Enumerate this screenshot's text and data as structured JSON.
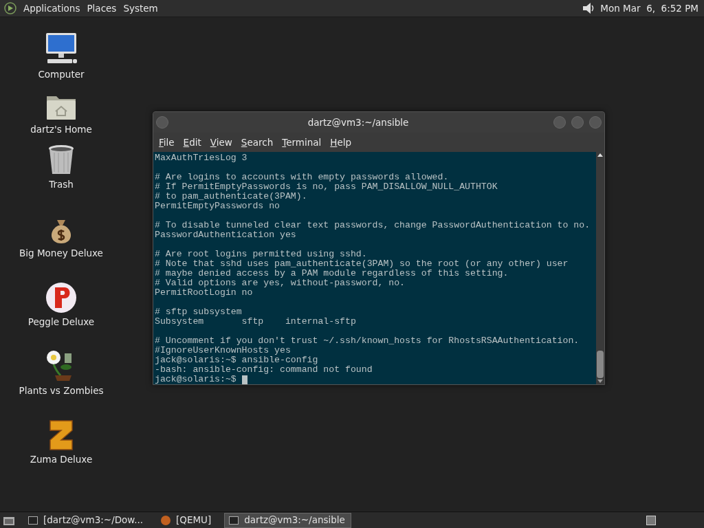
{
  "top_panel": {
    "menus": [
      "Applications",
      "Places",
      "System"
    ],
    "clock": "Mon Mar  6,  6:52 PM"
  },
  "desktop_icons": [
    {
      "label": "Computer",
      "kind": "computer"
    },
    {
      "label": "dartz's Home",
      "kind": "home"
    },
    {
      "label": "Trash",
      "kind": "trash"
    },
    {
      "label": "Big Money Deluxe",
      "kind": "moneybag"
    },
    {
      "label": "Peggle Deluxe",
      "kind": "peggle"
    },
    {
      "label": "Plants vs Zombies",
      "kind": "plant"
    },
    {
      "label": "Zuma Deluxe",
      "kind": "zuma"
    }
  ],
  "terminal": {
    "title": "dartz@vm3:~/ansible",
    "menu": [
      "File",
      "Edit",
      "View",
      "Search",
      "Terminal",
      "Help"
    ],
    "blocks": [
      [
        "MaxAuthTriesLog 3"
      ],
      [
        "# Are logins to accounts with empty passwords allowed.",
        "# If PermitEmptyPasswords is no, pass PAM_DISALLOW_NULL_AUTHTOK",
        "# to pam_authenticate(3PAM).",
        "PermitEmptyPasswords no"
      ],
      [
        "# To disable tunneled clear text passwords, change PasswordAuthentication to no.",
        "PasswordAuthentication yes"
      ],
      [
        "# Are root logins permitted using sshd.",
        "# Note that sshd uses pam_authenticate(3PAM) so the root (or any other) user",
        "# maybe denied access by a PAM module regardless of this setting.",
        "# Valid options are yes, without-password, no.",
        "PermitRootLogin no"
      ],
      [
        "# sftp subsystem",
        "Subsystem       sftp    internal-sftp"
      ],
      [
        "# Uncomment if you don't trust ~/.ssh/known_hosts for RhostsRSAAuthentication.",
        "#IgnoreUserKnownHosts yes",
        "jack@solaris:~$ ansible-config",
        "-bash: ansible-config: command not found"
      ]
    ],
    "prompt": "jack@solaris:~$ "
  },
  "taskbar": {
    "tasks": [
      {
        "label": "[dartz@vm3:~/Dow...",
        "kind": "terminal",
        "selected": false
      },
      {
        "label": "[QEMU]",
        "kind": "qemu",
        "selected": false
      },
      {
        "label": "dartz@vm3:~/ansible",
        "kind": "terminal",
        "selected": true
      }
    ]
  }
}
